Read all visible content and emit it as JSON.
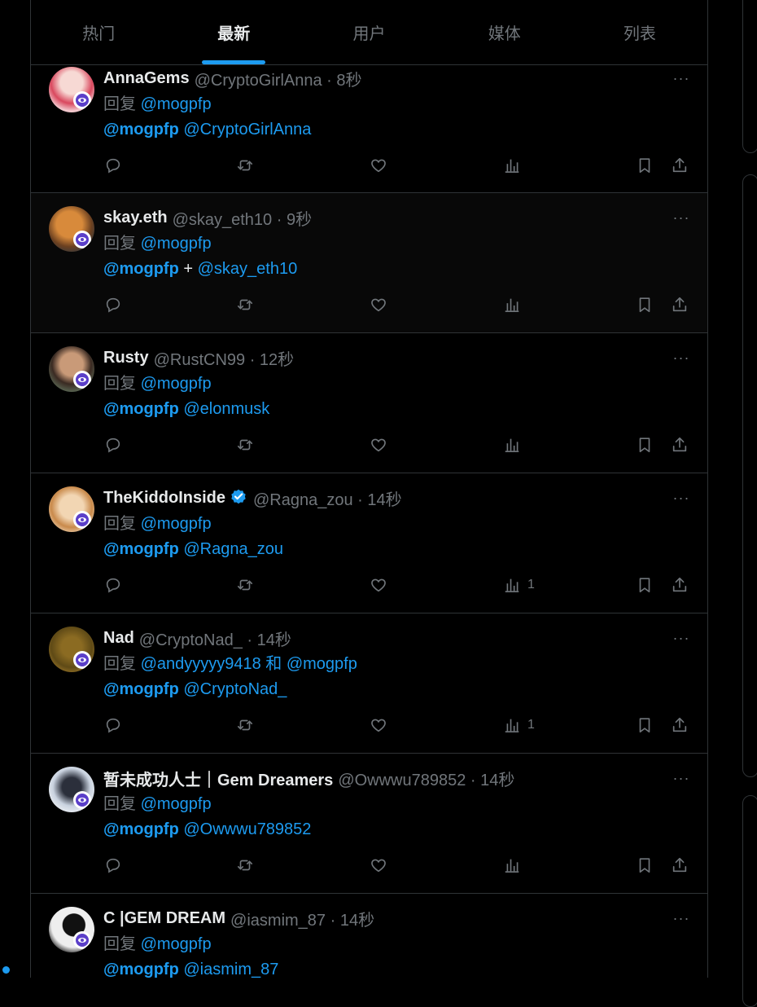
{
  "tabs": [
    {
      "label": "热门",
      "active": false
    },
    {
      "label": "最新",
      "active": true
    },
    {
      "label": "用户",
      "active": false
    },
    {
      "label": "媒体",
      "active": false
    },
    {
      "label": "列表",
      "active": false
    }
  ],
  "more_label": "···",
  "reply_prefix": "回复",
  "tweets": [
    {
      "name": "AnnaGems",
      "handle": "@CryptoGirlAnna · 8秒",
      "reply_to": "@mogpfp",
      "body_bold": "@mogpfp",
      "body_sep": " ",
      "body_rest": "@CryptoGirlAnna",
      "views": ""
    },
    {
      "name": "skay.eth",
      "handle": "@skay_eth10 · 9秒",
      "reply_to": "@mogpfp",
      "body_bold": "@mogpfp",
      "body_sep": " + ",
      "body_rest": "@skay_eth10",
      "views": ""
    },
    {
      "name": "Rusty",
      "handle": "@RustCN99 · 12秒",
      "reply_to": "@mogpfp",
      "body_bold": "@mogpfp",
      "body_sep": " ",
      "body_rest": "@elonmusk",
      "views": ""
    },
    {
      "name": "TheKiddoInside",
      "handle": "@Ragna_zou · 14秒",
      "reply_to": "@mogpfp",
      "body_bold": "@mogpfp",
      "body_sep": " ",
      "body_rest": "@Ragna_zou",
      "views": "1"
    },
    {
      "name": "Nad",
      "handle": "@CryptoNad_ · 14秒",
      "reply_to": "@andyyyyy9418 和 @mogpfp",
      "body_bold": "@mogpfp",
      "body_sep": " ",
      "body_rest": "@CryptoNad_",
      "views": "1"
    },
    {
      "name": "暂未成功人士｜Gem Dreamers",
      "handle": "@Owwwu789852 · 14秒",
      "reply_to": "@mogpfp",
      "body_bold": "@mogpfp",
      "body_sep": " ",
      "body_rest": "@Owwwu789852",
      "views": ""
    },
    {
      "name": "C |GEM DREAM",
      "handle": "@iasmim_87 · 14秒",
      "reply_to": "@mogpfp",
      "body_bold": "@mogpfp",
      "body_sep": " ",
      "body_rest": "@iasmim_87",
      "views": ""
    }
  ],
  "colors": {
    "accent": "#1d9bf0",
    "muted": "#71767b",
    "text": "#e7e9ea",
    "border": "#2f3336",
    "badge": "#5b3fc9"
  }
}
